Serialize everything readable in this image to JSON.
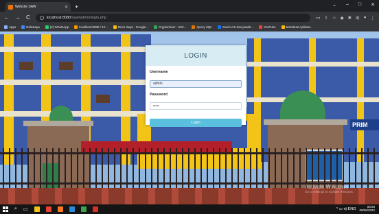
{
  "browser": {
    "tab_title": "Website SAW",
    "tab_close": "✕",
    "new_tab": "+",
    "win_controls": [
      "⌄",
      "–",
      "□",
      "✕"
    ],
    "nav": {
      "back": "←",
      "forward": "→",
      "reload": "C"
    },
    "url_host": "localhost:8080",
    "url_path": "/saw/admin/login.php",
    "tool_icons": [
      "⊶",
      "⇪",
      "☆",
      "◆",
      "✱",
      "⊞",
      "●",
      "⋮"
    ],
    "bookmarks": [
      {
        "label": "Apps",
        "color": "#8ab4f8"
      },
      {
        "label": "RelaSaya",
        "color": "#4285f4"
      },
      {
        "label": "(2) WhatsApp",
        "color": "#25d366"
      },
      {
        "label": "localhost:8080 / 12...",
        "color": "#f29900"
      },
      {
        "label": "Drive Saya - Google...",
        "color": "#fbbc04"
      },
      {
        "label": "Cryptominer - Stor...",
        "color": "#34a853"
      },
      {
        "label": "Query SQL",
        "color": "#e37400"
      },
      {
        "label": "Soal UAS dan jawab...",
        "color": "#1a73e8"
      },
      {
        "label": "YouTube",
        "color": "#ea4335"
      },
      {
        "label": "Membuat Aplikasi...",
        "color": "#fbbc04"
      }
    ]
  },
  "login": {
    "title": "LOGIN",
    "username_label": "Username",
    "username_value": "admin",
    "password_label": "Password",
    "password_value": "•••••",
    "button_label": "Login"
  },
  "scene": {
    "sign_text": "PRIM"
  },
  "watermark": {
    "title": "Activate Windows",
    "subtitle": "Go to Settings to activate Windows."
  },
  "taskbar": {
    "search_glyph": "⌕",
    "taskview_glyph": "▭",
    "apps": [
      {
        "name": "file-explorer",
        "color": "#f2c418"
      },
      {
        "name": "chrome",
        "color": "#ea4335"
      },
      {
        "name": "xampp",
        "color": "#fb7a24"
      },
      {
        "name": "vscode",
        "color": "#2a8bd8"
      },
      {
        "name": "app-green",
        "color": "#3fa34d"
      },
      {
        "name": "app-red",
        "color": "#d93025"
      }
    ],
    "tray": {
      "icons": "^ ▭ ◂) ENG",
      "time": "08:20",
      "date": "09/06/2022"
    }
  }
}
